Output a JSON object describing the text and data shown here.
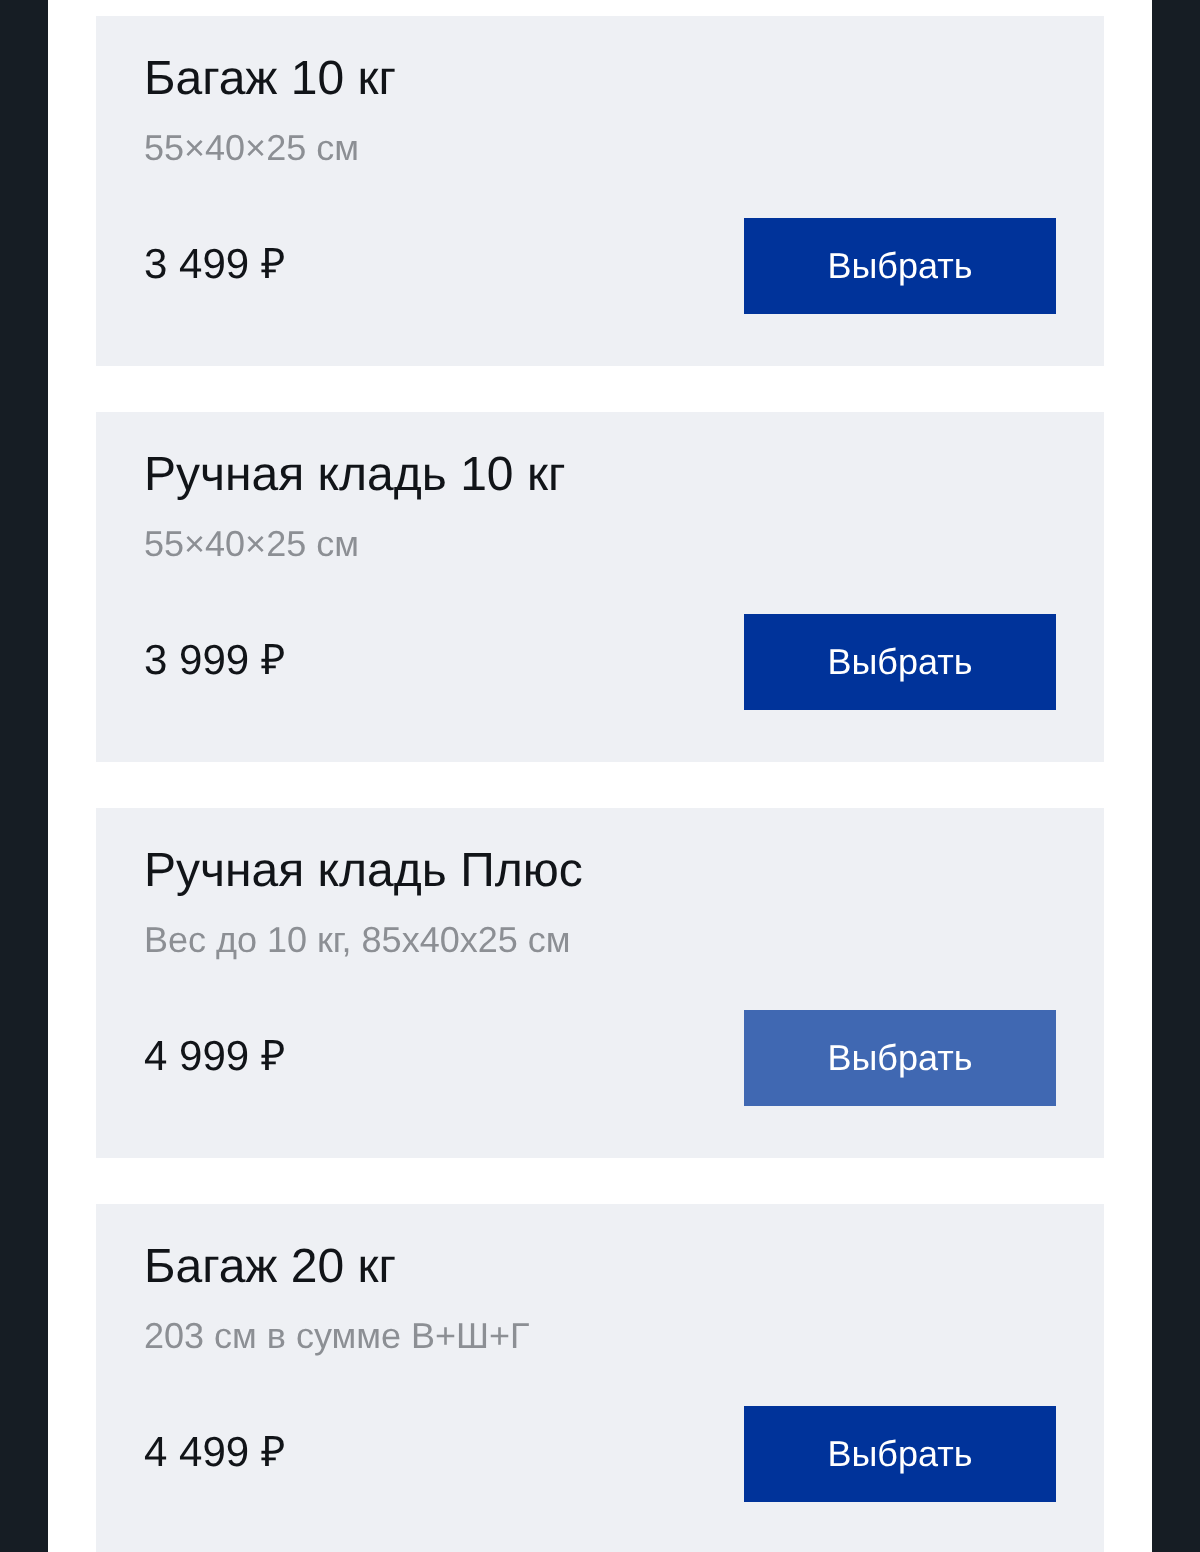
{
  "options": [
    {
      "title": "Багаж 10 кг",
      "details": "55×40×25 см",
      "price": "3 499 ₽",
      "button": {
        "label": "Выбрать",
        "highlighted": false
      }
    },
    {
      "title": "Ручная кладь 10 кг",
      "details": "55×40×25 см",
      "price": "3 999 ₽",
      "button": {
        "label": "Выбрать",
        "highlighted": false
      }
    },
    {
      "title": "Ручная кладь Плюс",
      "details": "Вес до 10 кг, 85x40x25 см",
      "price": "4 999 ₽",
      "button": {
        "label": "Выбрать",
        "highlighted": true
      }
    },
    {
      "title": "Багаж 20 кг",
      "details": "203 см в сумме В+Ш+Г",
      "price": "4 499 ₽",
      "button": {
        "label": "Выбрать",
        "highlighted": false
      }
    }
  ]
}
